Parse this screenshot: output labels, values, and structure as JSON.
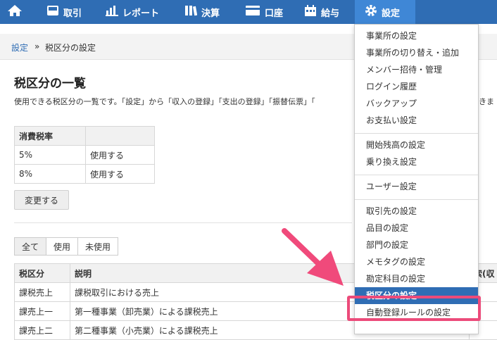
{
  "nav": {
    "items": [
      {
        "label": "",
        "icon": "home-icon"
      },
      {
        "label": "取引",
        "icon": "inbox-icon"
      },
      {
        "label": "レポート",
        "icon": "bar-chart-icon"
      },
      {
        "label": "決算",
        "icon": "books-icon"
      },
      {
        "label": "口座",
        "icon": "card-icon"
      },
      {
        "label": "給与",
        "icon": "calendar-icon"
      },
      {
        "label": "設定",
        "icon": "gear-icon"
      }
    ],
    "active_index": 6
  },
  "breadcrumb": {
    "link": "設定",
    "sep": "»",
    "current": "税区分の設定"
  },
  "page": {
    "title": "税区分の一覧",
    "description": "使用できる税区分の一覧です。「設定」から「収入の登録」「支出の登録」「振替伝票」「",
    "description_tail": "きま"
  },
  "rate_table": {
    "headers": [
      "消費税率",
      ""
    ],
    "rows": [
      [
        "5%",
        "使用する"
      ],
      [
        "8%",
        "使用する"
      ]
    ]
  },
  "change_button": "変更する",
  "filters": [
    "全て",
    "使用",
    "未使用"
  ],
  "tax_table": {
    "headers": [
      "税区分",
      "説明",
      "索(収"
    ],
    "rows": [
      [
        "課税売上",
        "課税取引における売上"
      ],
      [
        "課売上一",
        "第一種事業（卸売業）による課税売上"
      ],
      [
        "課売上二",
        "第二種事業（小売業）による課税売上"
      ]
    ]
  },
  "dropdown": {
    "groups": [
      [
        "事業所の設定",
        "事業所の切り替え・追加",
        "メンバー招待・管理",
        "ログイン履歴",
        "バックアップ",
        "お支払い設定"
      ],
      [
        "開始残高の設定",
        "乗り換え設定"
      ],
      [
        "ユーザー設定"
      ],
      [
        "取引先の設定",
        "品目の設定",
        "部門の設定",
        "メモタグの設定",
        "勘定科目の設定",
        "税区分の設定",
        "自動登録ルールの設定"
      ]
    ],
    "selected": "税区分の設定"
  },
  "colors": {
    "nav": "#2f6db4",
    "nav_active": "#3f87d6",
    "highlight": "#ec4b7a",
    "arrow": "#f04a7b"
  }
}
